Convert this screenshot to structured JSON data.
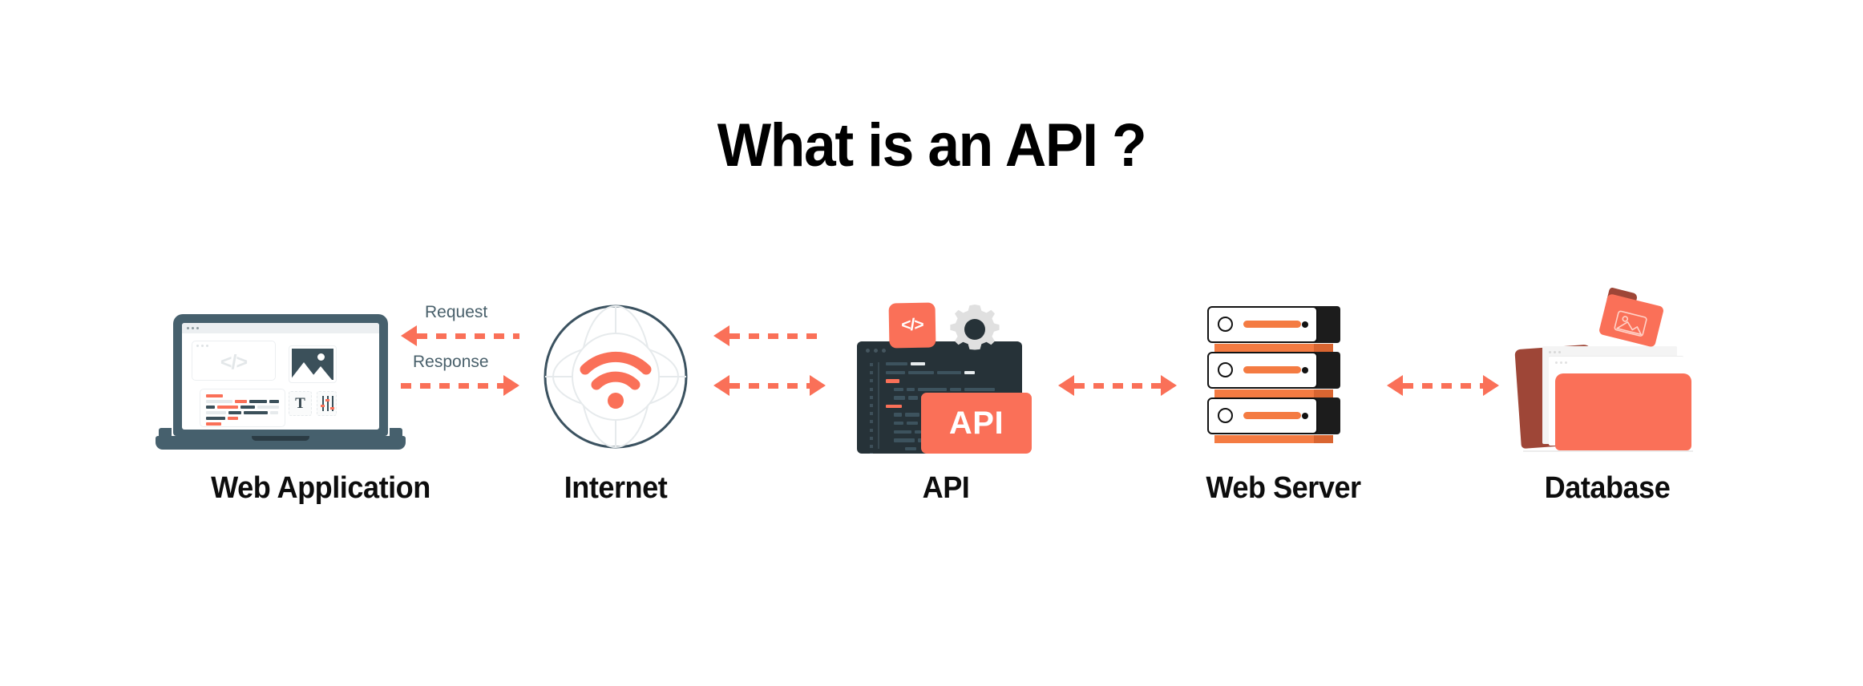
{
  "page": {
    "title": "What is an API ?",
    "background": "#ffffff"
  },
  "colors": {
    "accent_orange": "#fa7058",
    "server_orange": "#f47b42",
    "dark_slate": "#263238",
    "laptop_slate": "#46606d",
    "label_black": "#0d0d0d",
    "arrow_label_slate": "#49606b",
    "database_dark_red": "#9e4637",
    "gear_gray": "#e0e0e0"
  },
  "nodes": [
    {
      "id": "web-application",
      "label": "Web Application",
      "icon": "laptop-icon"
    },
    {
      "id": "internet",
      "label": "Internet",
      "icon": "globe-wifi-icon"
    },
    {
      "id": "api",
      "label": "API",
      "icon": "api-code-window-icon"
    },
    {
      "id": "web-server",
      "label": "Web Server",
      "icon": "server-rack-icon"
    },
    {
      "id": "database",
      "label": "Database",
      "icon": "folder-stack-icon"
    }
  ],
  "laptop": {
    "code_glyph": "</>",
    "text_tool_glyph": "T"
  },
  "api_node": {
    "badge_glyph": "</>",
    "panel_label": "API"
  },
  "arrows": [
    {
      "id": "webapp-internet-request",
      "label": "Request",
      "direction": "left",
      "style": "dashed",
      "color": "#fa7058"
    },
    {
      "id": "webapp-internet-response",
      "label": "Response",
      "direction": "right",
      "style": "dashed",
      "color": "#fa7058"
    },
    {
      "id": "internet-api-top",
      "label": "",
      "direction": "left",
      "style": "dashed",
      "color": "#fa7058"
    },
    {
      "id": "internet-api-bottom",
      "label": "",
      "direction": "both",
      "style": "dashed",
      "color": "#fa7058"
    },
    {
      "id": "api-webserver",
      "label": "",
      "direction": "both",
      "style": "dashed",
      "color": "#fa7058"
    },
    {
      "id": "webserver-database",
      "label": "",
      "direction": "both",
      "style": "dashed",
      "color": "#fa7058"
    }
  ],
  "chart_data": {
    "type": "diagram",
    "title": "What is an API ?",
    "flow": [
      "Web Application",
      "Internet",
      "API",
      "Web Server",
      "Database"
    ],
    "edges": [
      {
        "from": "Web Application",
        "to": "Internet",
        "label": "Request",
        "direction": "left"
      },
      {
        "from": "Web Application",
        "to": "Internet",
        "label": "Response",
        "direction": "right"
      },
      {
        "from": "Internet",
        "to": "API",
        "label": "",
        "direction": "left"
      },
      {
        "from": "Internet",
        "to": "API",
        "label": "",
        "direction": "both"
      },
      {
        "from": "API",
        "to": "Web Server",
        "label": "",
        "direction": "both"
      },
      {
        "from": "Web Server",
        "to": "Database",
        "label": "",
        "direction": "both"
      }
    ]
  }
}
